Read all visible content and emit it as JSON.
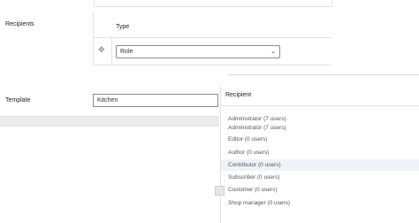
{
  "form": {
    "recipients_label": "Recipients",
    "template_label": "Template",
    "type_header": "Type",
    "type_select_value": "Role",
    "template_value": "Kitchen"
  },
  "dropdown": {
    "header": "Recipient",
    "items": [
      "Administrator (7 users)",
      "Administrator (7 users)",
      "Editor (0 users)",
      "Author (0 users)",
      "Contributor (0 users)",
      "Subscriber (0 users)",
      "Customer (0 users)",
      "Shop manager (0 users)"
    ]
  },
  "icons": {
    "drag_handle": "move-icon",
    "select_arrow": "chevron-down-icon"
  }
}
